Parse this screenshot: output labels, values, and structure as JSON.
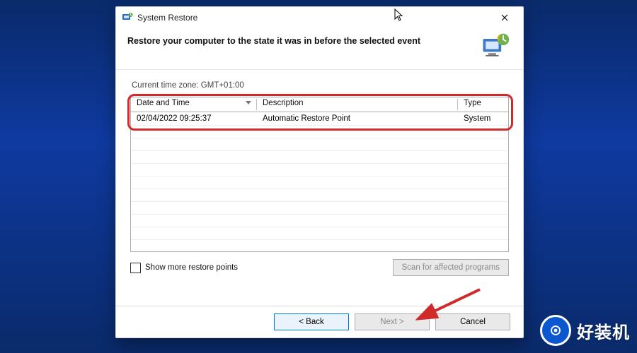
{
  "window": {
    "title": "System Restore",
    "headline": "Restore your computer to the state it was in before the selected event"
  },
  "timezone_label": "Current time zone: GMT+01:00",
  "table": {
    "columns": {
      "datetime": "Date and Time",
      "description": "Description",
      "type": "Type"
    },
    "rows": [
      {
        "datetime": "02/04/2022 09:25:37",
        "description": "Automatic Restore Point",
        "type": "System"
      }
    ]
  },
  "checkbox_label": "Show more restore points",
  "buttons": {
    "scan": "Scan for affected programs",
    "back": "< Back",
    "next": "Next >",
    "cancel": "Cancel"
  },
  "watermark_text": "好装机"
}
